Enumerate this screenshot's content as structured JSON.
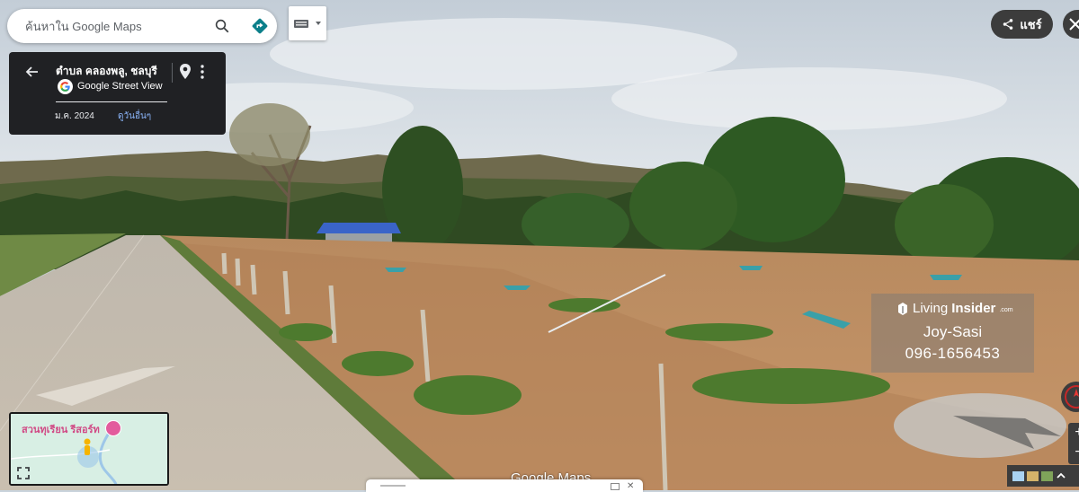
{
  "search": {
    "placeholder": "ค้นหาใน Google Maps",
    "search_icon": "search-icon",
    "directions_icon": "directions-icon"
  },
  "keyboard": {
    "icon": "keyboard-icon"
  },
  "share": {
    "label": "แชร์",
    "icon": "share-icon"
  },
  "info_card": {
    "title": "ตำบล คลองพลู, ชลบุรี",
    "provider": "Google Street View",
    "date": "ม.ค. 2024",
    "other_dates_link": "ดูวันอื่นๆ"
  },
  "watermark": {
    "brand_light": "Living",
    "brand_bold": "Insider",
    "brand_suffix": ".com",
    "name": "Joy-Sasi",
    "phone": "096-1656453"
  },
  "minimap": {
    "place_label": "สวนทุเรียน รีสอร์ท"
  },
  "footer": {
    "logo_text": "Google Maps"
  },
  "colors": {
    "panel_dark": "#202124",
    "link_blue": "#8ab4f8",
    "directions_teal": "#1a73e8",
    "minimap_poi": "#e35b9d"
  }
}
